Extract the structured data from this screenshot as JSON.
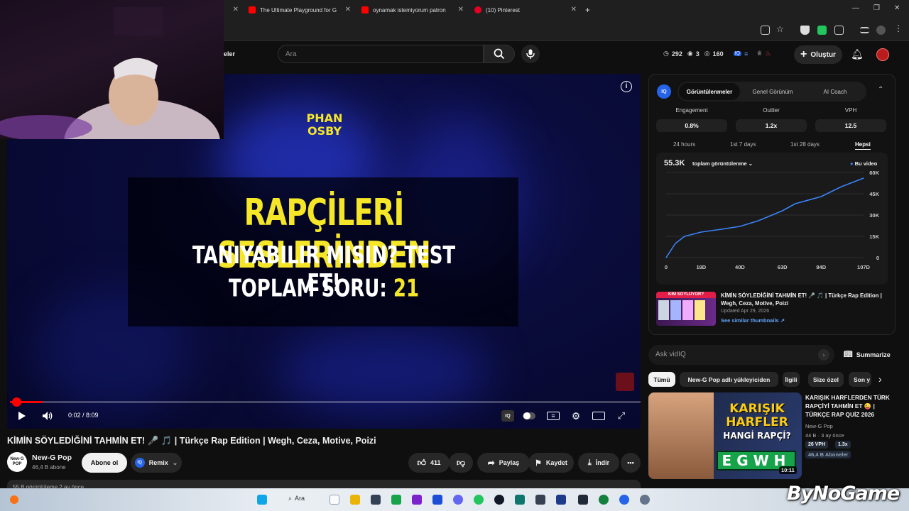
{
  "browser": {
    "tabs": [
      {
        "title": "",
        "color": "#ff0000"
      },
      {
        "title": "The Ultimate Playground for G",
        "color": "#ff0000"
      },
      {
        "title": "oynamak istemiyorum patron",
        "color": "#ff0000"
      },
      {
        "title": "(10) Pinterest",
        "color": "#e60023"
      }
    ],
    "new_tab": "+"
  },
  "youtube_header": {
    "menu_partial": "eler",
    "search_placeholder": "Ara",
    "stats": {
      "views": "292",
      "watching": "3",
      "seen": "160"
    },
    "create_label": "Oluştur"
  },
  "video": {
    "logo_line1": "PHAN",
    "logo_line2": "OSBY",
    "headline": "RAPÇİLERİ SESLERİNDEN",
    "subline": "TANIYABILIR MISIN? TEST ET!",
    "count_label": "TOPLAM SORU:",
    "count_value": "21",
    "time": "0:02 / 8:09",
    "progress_fraction": 0.004
  },
  "title": "KİMİN SÖYLEDİĞİNİ TAHMİN ET! 🎤 🎵 | Türkçe Rap Edition | Wegh, Ceza, Motive, Poizi",
  "channel": {
    "avatar_text": "New·G POP",
    "name": "New-G Pop",
    "subs": "46,4 B abone",
    "subscribe_label": "Abone ol",
    "remix_label": "Remix"
  },
  "actions": {
    "likes": "411",
    "share": "Paylaş",
    "save": "Kaydet",
    "download": "İndir"
  },
  "description_peek": "55 B görüntüleme  2 ay önce",
  "vidiq": {
    "logo": "IQ",
    "tabs": [
      "Görüntülenmeler",
      "Genel Görünüm",
      "AI Coach"
    ],
    "metrics": [
      {
        "label": "Engagement",
        "value": "0.8%"
      },
      {
        "label": "Outlier",
        "value": "1.2x"
      },
      {
        "label": "VPH",
        "value": "12.5"
      }
    ],
    "ranges": [
      "24 hours",
      "1st 7 days",
      "1st 28 days",
      "Hepsi"
    ],
    "total": "55.3K",
    "total_label": "toplam görüntülenme",
    "legend": "Bu video",
    "thumb_caption": "KİM SÖYLÜYOR?",
    "related_title": "KİMİN SÖYLEDİĞİNİ TAHMİN ET! 🎤 🎵 | Türkçe Rap Edition | Wegh, Ceza, Motive, Poizi",
    "updated": "Updated Apr 29, 2026",
    "similar_link": "See similar thumbnails ↗"
  },
  "chart_data": {
    "type": "line",
    "x_ticks": [
      "0",
      "19D",
      "40D",
      "63D",
      "84D",
      "107D"
    ],
    "y_ticks": [
      "0",
      "15K",
      "30K",
      "45K",
      "60K"
    ],
    "ylim": [
      0,
      60000
    ],
    "xlim": [
      0,
      107
    ],
    "series": [
      {
        "color": "#3b82f6",
        "x": [
          0,
          5,
          10,
          19,
          30,
          40,
          50,
          63,
          70,
          84,
          95,
          107
        ],
        "y": [
          0,
          10000,
          15000,
          18000,
          20000,
          22000,
          26000,
          33000,
          38000,
          43000,
          50000,
          56000
        ]
      }
    ]
  },
  "sidebar": {
    "ask_placeholder": "Ask vidIQ",
    "summarize": "Summarize",
    "chips": [
      "Tümü",
      "New-G Pop adlı yükleyiciden",
      "İlgili",
      "Size özel",
      "Son y"
    ],
    "rec": {
      "thumb_line1": "KARIŞIK",
      "thumb_line2": "HARFLER",
      "thumb_line3": "HANGİ RAPÇİ?",
      "thumb_letters": "EGWH",
      "duration": "10:11",
      "title": "KARIŞIK HARFLERDEN TÜRK RAPÇİYİ TAHMİN ET 😜 | TÜRKÇE RAP QUİZ 2026",
      "channel": "New-G Pop",
      "meta": "44 B · 3 ay önce",
      "vph": "26 VPH",
      "outlier": "1.3x",
      "subs": "46,4 B Aboneler"
    }
  },
  "taskbar": {
    "search_label": "Ara"
  },
  "watermark": "ByNoGame"
}
